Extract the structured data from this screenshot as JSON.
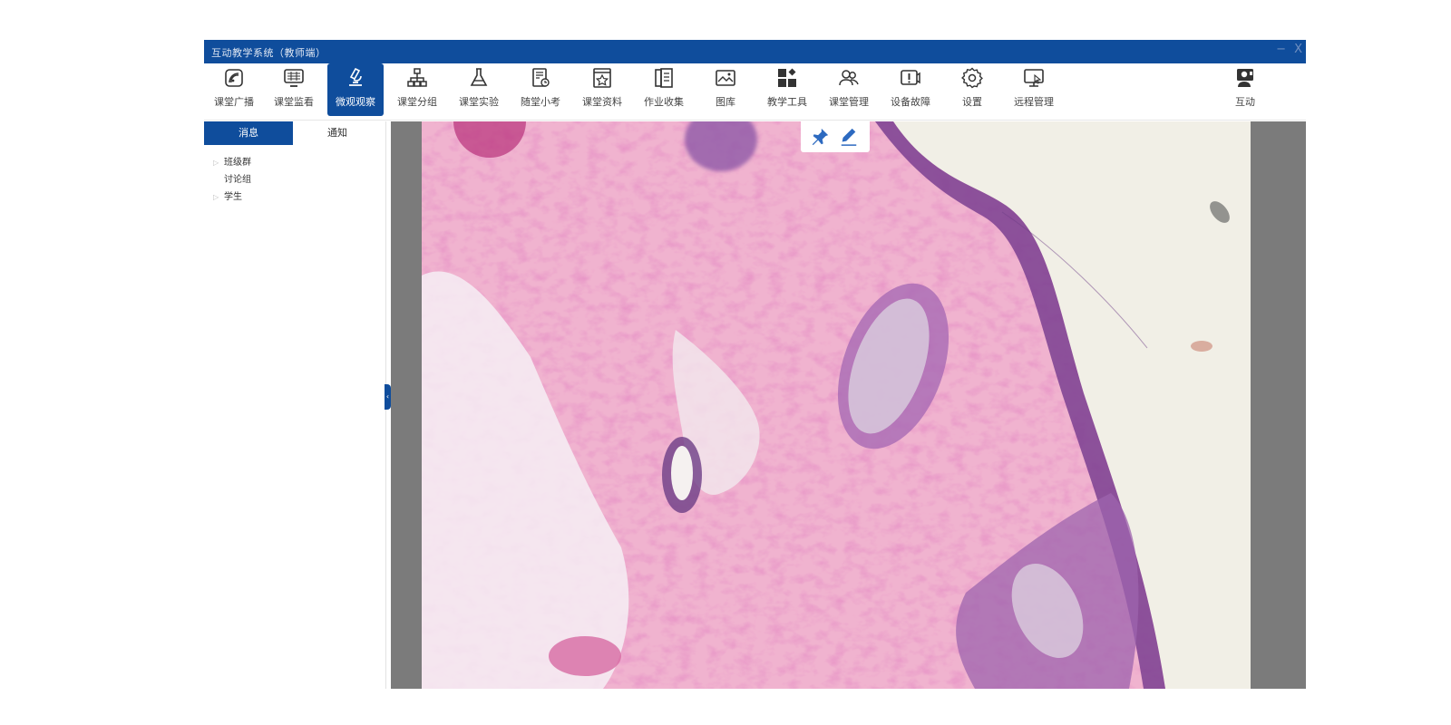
{
  "window": {
    "title": "互动教学系统（教师端）",
    "minimize": "−",
    "close": "X"
  },
  "toolbar": {
    "items": [
      {
        "id": "broadcast",
        "label": "课堂广播",
        "icon": "broadcast-icon"
      },
      {
        "id": "monitor",
        "label": "课堂监看",
        "icon": "monitor-icon"
      },
      {
        "id": "micro",
        "label": "微观观察",
        "icon": "microscope-icon",
        "active": true
      },
      {
        "id": "group",
        "label": "课堂分组",
        "icon": "org-chart-icon"
      },
      {
        "id": "experiment",
        "label": "课堂实验",
        "icon": "flask-icon"
      },
      {
        "id": "quiz",
        "label": "随堂小考",
        "icon": "quiz-icon"
      },
      {
        "id": "materials",
        "label": "课堂资料",
        "icon": "materials-icon"
      },
      {
        "id": "homework",
        "label": "作业收集",
        "icon": "homework-icon"
      },
      {
        "id": "gallery",
        "label": "图库",
        "icon": "image-icon"
      },
      {
        "id": "tools",
        "label": "教学工具",
        "icon": "tools-grid-icon"
      },
      {
        "id": "manage",
        "label": "课堂管理",
        "icon": "users-icon"
      },
      {
        "id": "fault",
        "label": "设备故障",
        "icon": "alert-screen-icon"
      },
      {
        "id": "settings",
        "label": "设置",
        "icon": "gear-icon"
      },
      {
        "id": "remote",
        "label": "远程管理",
        "icon": "remote-desktop-icon"
      }
    ],
    "interact": {
      "label": "互动",
      "icon": "teacher-icon"
    }
  },
  "panel": {
    "tabs": [
      "消息",
      "通知"
    ],
    "tree": [
      {
        "label": "班级群",
        "expandable": true
      },
      {
        "label": "讨论组",
        "expandable": false
      },
      {
        "label": "学生",
        "expandable": true
      }
    ]
  },
  "viewer": {
    "image": "histology-micrograph",
    "tools": [
      "pin-icon",
      "pen-icon"
    ]
  },
  "colors": {
    "primary": "#0f4d9c",
    "viewer_bg": "#7b7b7b",
    "tissue_pink": "#e58bb5",
    "tissue_purple": "#7a3f91"
  }
}
